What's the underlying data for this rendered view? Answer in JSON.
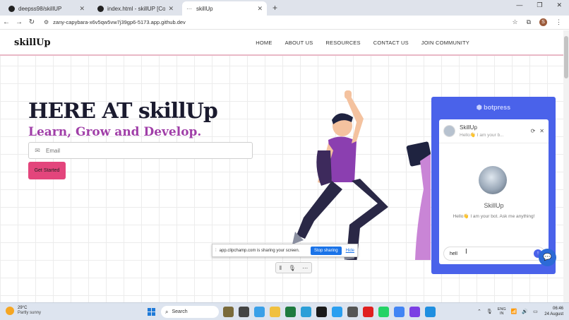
{
  "browser": {
    "tabs": [
      {
        "title": "deepss98/skillUP",
        "active": false
      },
      {
        "title": "index.html - skillUP [Codespac",
        "active": false
      },
      {
        "title": "skillUp",
        "active": true
      }
    ],
    "new_tab": "+",
    "window_controls": {
      "minimize": "—",
      "maximize": "❐",
      "close": "✕"
    },
    "url": "zany-capybara-x6v5qw5vw7j39gp6-5173.app.github.dev",
    "profile_initial": "S"
  },
  "site": {
    "logo": "skillUp",
    "nav": [
      "HOME",
      "ABOUT US",
      "RESOURCES",
      "CONTACT US",
      "JOIN COMMUNITY"
    ],
    "hero_title": "HERE AT skillUp",
    "hero_subtitle": "Learn, Grow and Develop.",
    "email_placeholder": "Email",
    "cta_label": "Get Started",
    "colors": {
      "accent_pink": "#e3457c",
      "subtitle_purple": "#a03fa8",
      "nav_border": "#e9b8c6"
    }
  },
  "botpress": {
    "brand": "botpress",
    "bot_name": "SkillUp",
    "preview_text": "Hello👋 I am your b...",
    "description": "Hello👋 I am your bot. Ask me anything!",
    "composer_value": "hell",
    "colors": {
      "panel": "#4a62ea"
    }
  },
  "screen_share": {
    "message": "app.clipchamp.com is sharing your screen.",
    "stop_label": "Stop sharing",
    "hide_label": "Hide"
  },
  "taskbar": {
    "weather_temp": "29°C",
    "weather_desc": "Partly sunny",
    "search_label": "Search",
    "lang_line1": "ENG",
    "lang_line2": "IN",
    "time": "06:46",
    "date": "24 August"
  }
}
